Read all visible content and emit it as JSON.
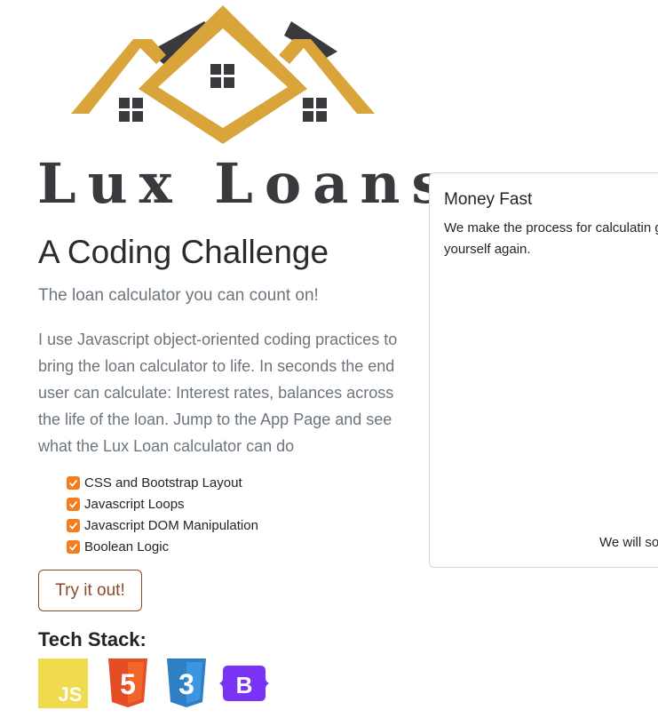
{
  "brand": {
    "title": "Lux Loans",
    "logo_icon": "house-roof-logo-icon",
    "logo_color": "#d9a43a",
    "logo_dark": "#3a3a3e"
  },
  "hero": {
    "subtitle": "A Coding Challenge",
    "tagline": "The loan calculator you can count on!",
    "intro": "I use Javascript object-oriented coding practices to bring the loan calculator to life. In seconds the end user can calculate: Interest rates, balances across the life of the loan. Jump to the App Page and see what the Lux Loan calculator can do"
  },
  "features": [
    {
      "label": "CSS and Bootstrap Layout",
      "checked": true
    },
    {
      "label": "Javascript Loops",
      "checked": true
    },
    {
      "label": "Javascript DOM Manipulation",
      "checked": true
    },
    {
      "label": "Boolean Logic",
      "checked": true
    }
  ],
  "cta": {
    "label": "Try it out!",
    "color": "#8b4a2b"
  },
  "tech_stack": {
    "heading": "Tech Stack:",
    "icons": [
      {
        "name": "javascript-icon",
        "label": "JS",
        "color": "#f0db4f"
      },
      {
        "name": "html5-icon",
        "label": "5",
        "color": "#e44d26"
      },
      {
        "name": "css3-icon",
        "label": "3",
        "color": "#2f7fc4"
      },
      {
        "name": "bootstrap-icon",
        "label": "B",
        "color": "#7a32f5"
      }
    ]
  },
  "card": {
    "title": "Money Fast",
    "text": "We make the process for calculatin guess yourself again.",
    "footer_text": "We will so"
  },
  "colors": {
    "checkbox": "#f57c20",
    "muted_text": "#6c757d"
  }
}
